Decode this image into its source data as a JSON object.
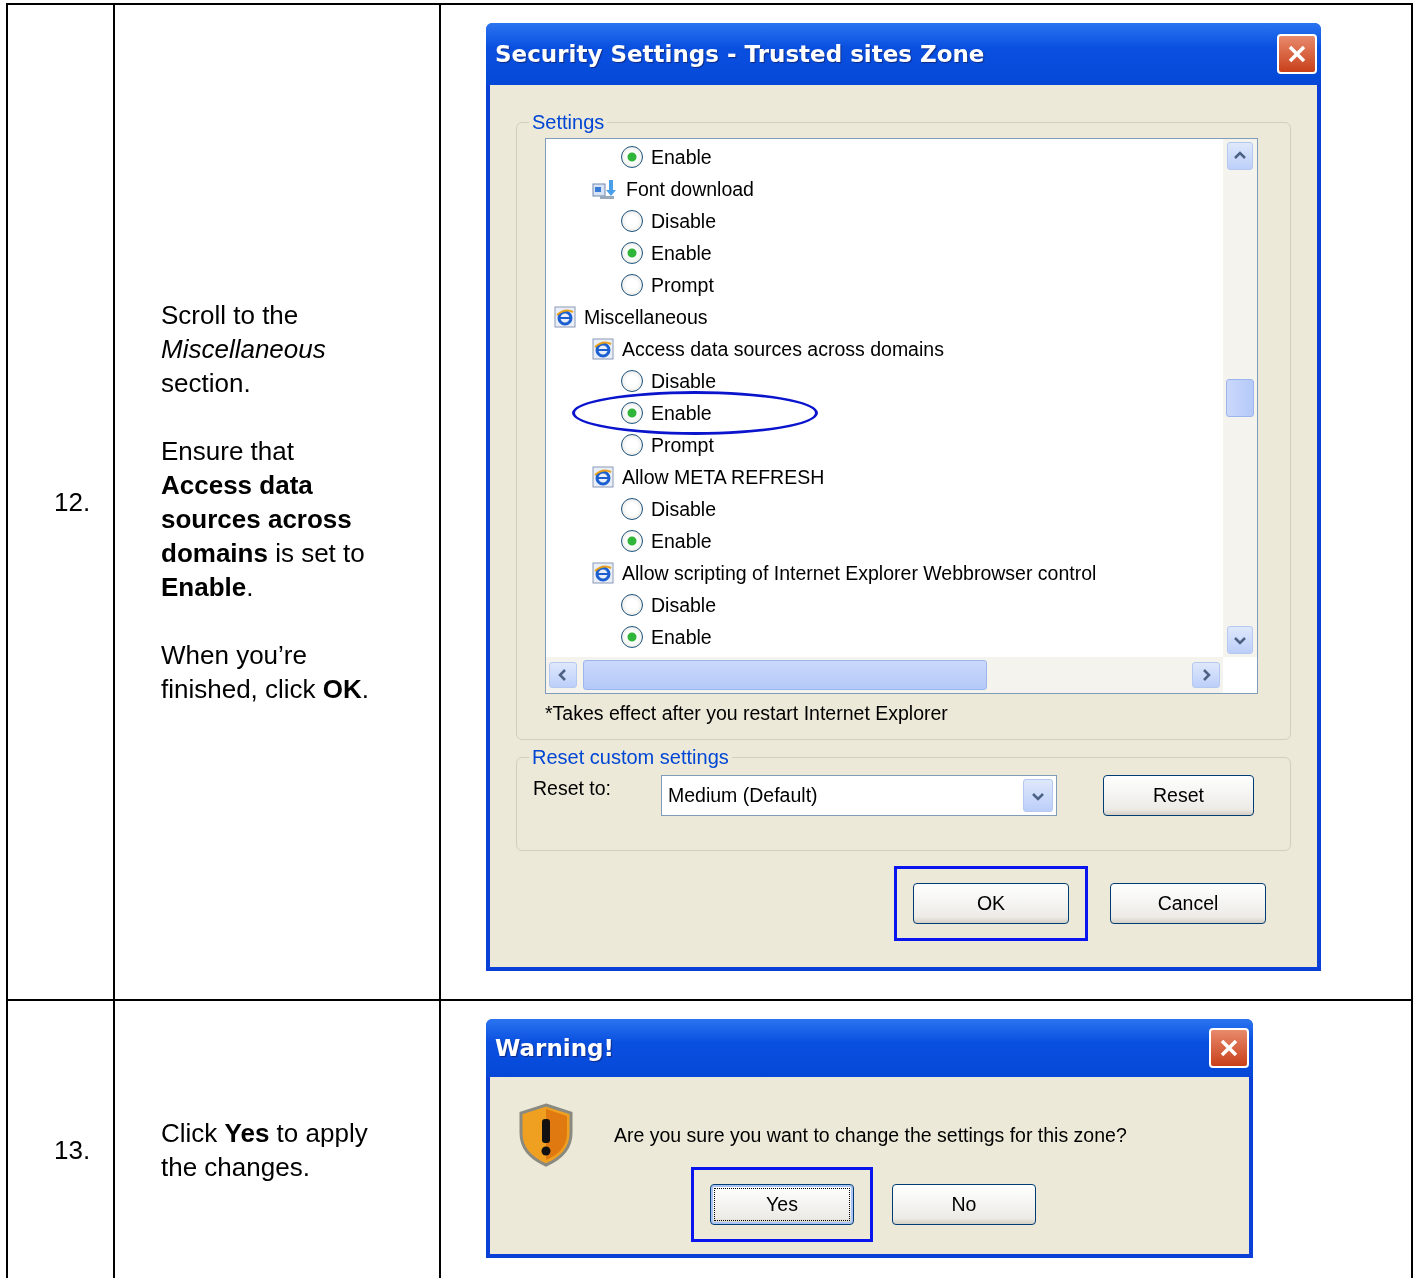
{
  "steps": [
    {
      "number": "12.",
      "instructions": [
        "Scroll to the *Miscellaneous* section.",
        "Ensure that **Access data sources across domains** is set to **Enable**.",
        "When you’re finished, click **OK**."
      ],
      "dialog": {
        "kind": "settings",
        "title": "Security Settings - Trusted sites Zone",
        "settings_group": {
          "legend": "Settings",
          "tree": [
            {
              "kind": "category",
              "children": [
                {
                  "kind": "setting",
                  "children": [
                    {
                      "kind": "radio",
                      "label": "Enable",
                      "selected": true
                    }
                  ]
                },
                {
                  "kind": "download",
                  "label": "Font download",
                  "children": [
                    {
                      "kind": "radio",
                      "label": "Disable",
                      "selected": false
                    },
                    {
                      "kind": "radio",
                      "label": "Enable",
                      "selected": true
                    },
                    {
                      "kind": "radio",
                      "label": "Prompt",
                      "selected": false
                    }
                  ]
                }
              ]
            },
            {
              "kind": "category",
              "label": "Miscellaneous",
              "children": [
                {
                  "kind": "setting",
                  "label": "Access data sources across domains",
                  "children": [
                    {
                      "kind": "radio",
                      "label": "Disable",
                      "selected": false
                    },
                    {
                      "kind": "radio",
                      "label": "Enable",
                      "selected": true,
                      "highlighted": true
                    },
                    {
                      "kind": "radio",
                      "label": "Prompt",
                      "selected": false
                    }
                  ]
                },
                {
                  "kind": "setting",
                  "label": "Allow META REFRESH",
                  "children": [
                    {
                      "kind": "radio",
                      "label": "Disable",
                      "selected": false
                    },
                    {
                      "kind": "radio",
                      "label": "Enable",
                      "selected": true
                    }
                  ]
                },
                {
                  "kind": "setting",
                  "label": "Allow scripting of Internet Explorer Webbrowser control",
                  "children": [
                    {
                      "kind": "radio",
                      "label": "Disable",
                      "selected": false
                    },
                    {
                      "kind": "radio",
                      "label": "Enable",
                      "selected": true
                    }
                  ]
                }
              ]
            }
          ],
          "note": "*Takes effect after you restart Internet Explorer"
        },
        "reset_group": {
          "legend": "Reset custom settings",
          "label": "Reset to:",
          "select_value": "Medium (Default)",
          "reset_button": "Reset"
        },
        "buttons": [
          {
            "label": "OK",
            "highlighted": true,
            "focused": false
          },
          {
            "label": "Cancel",
            "highlighted": false,
            "focused": false
          }
        ]
      }
    },
    {
      "number": "13.",
      "instructions": [
        "Click **Yes** to apply the changes."
      ],
      "dialog": {
        "kind": "warning",
        "title": "Warning!",
        "message": "Are you sure you want to change the settings for this zone?",
        "buttons": [
          {
            "label": "Yes",
            "highlighted": true,
            "focused": true
          },
          {
            "label": "No",
            "highlighted": false,
            "focused": false
          }
        ]
      }
    }
  ]
}
